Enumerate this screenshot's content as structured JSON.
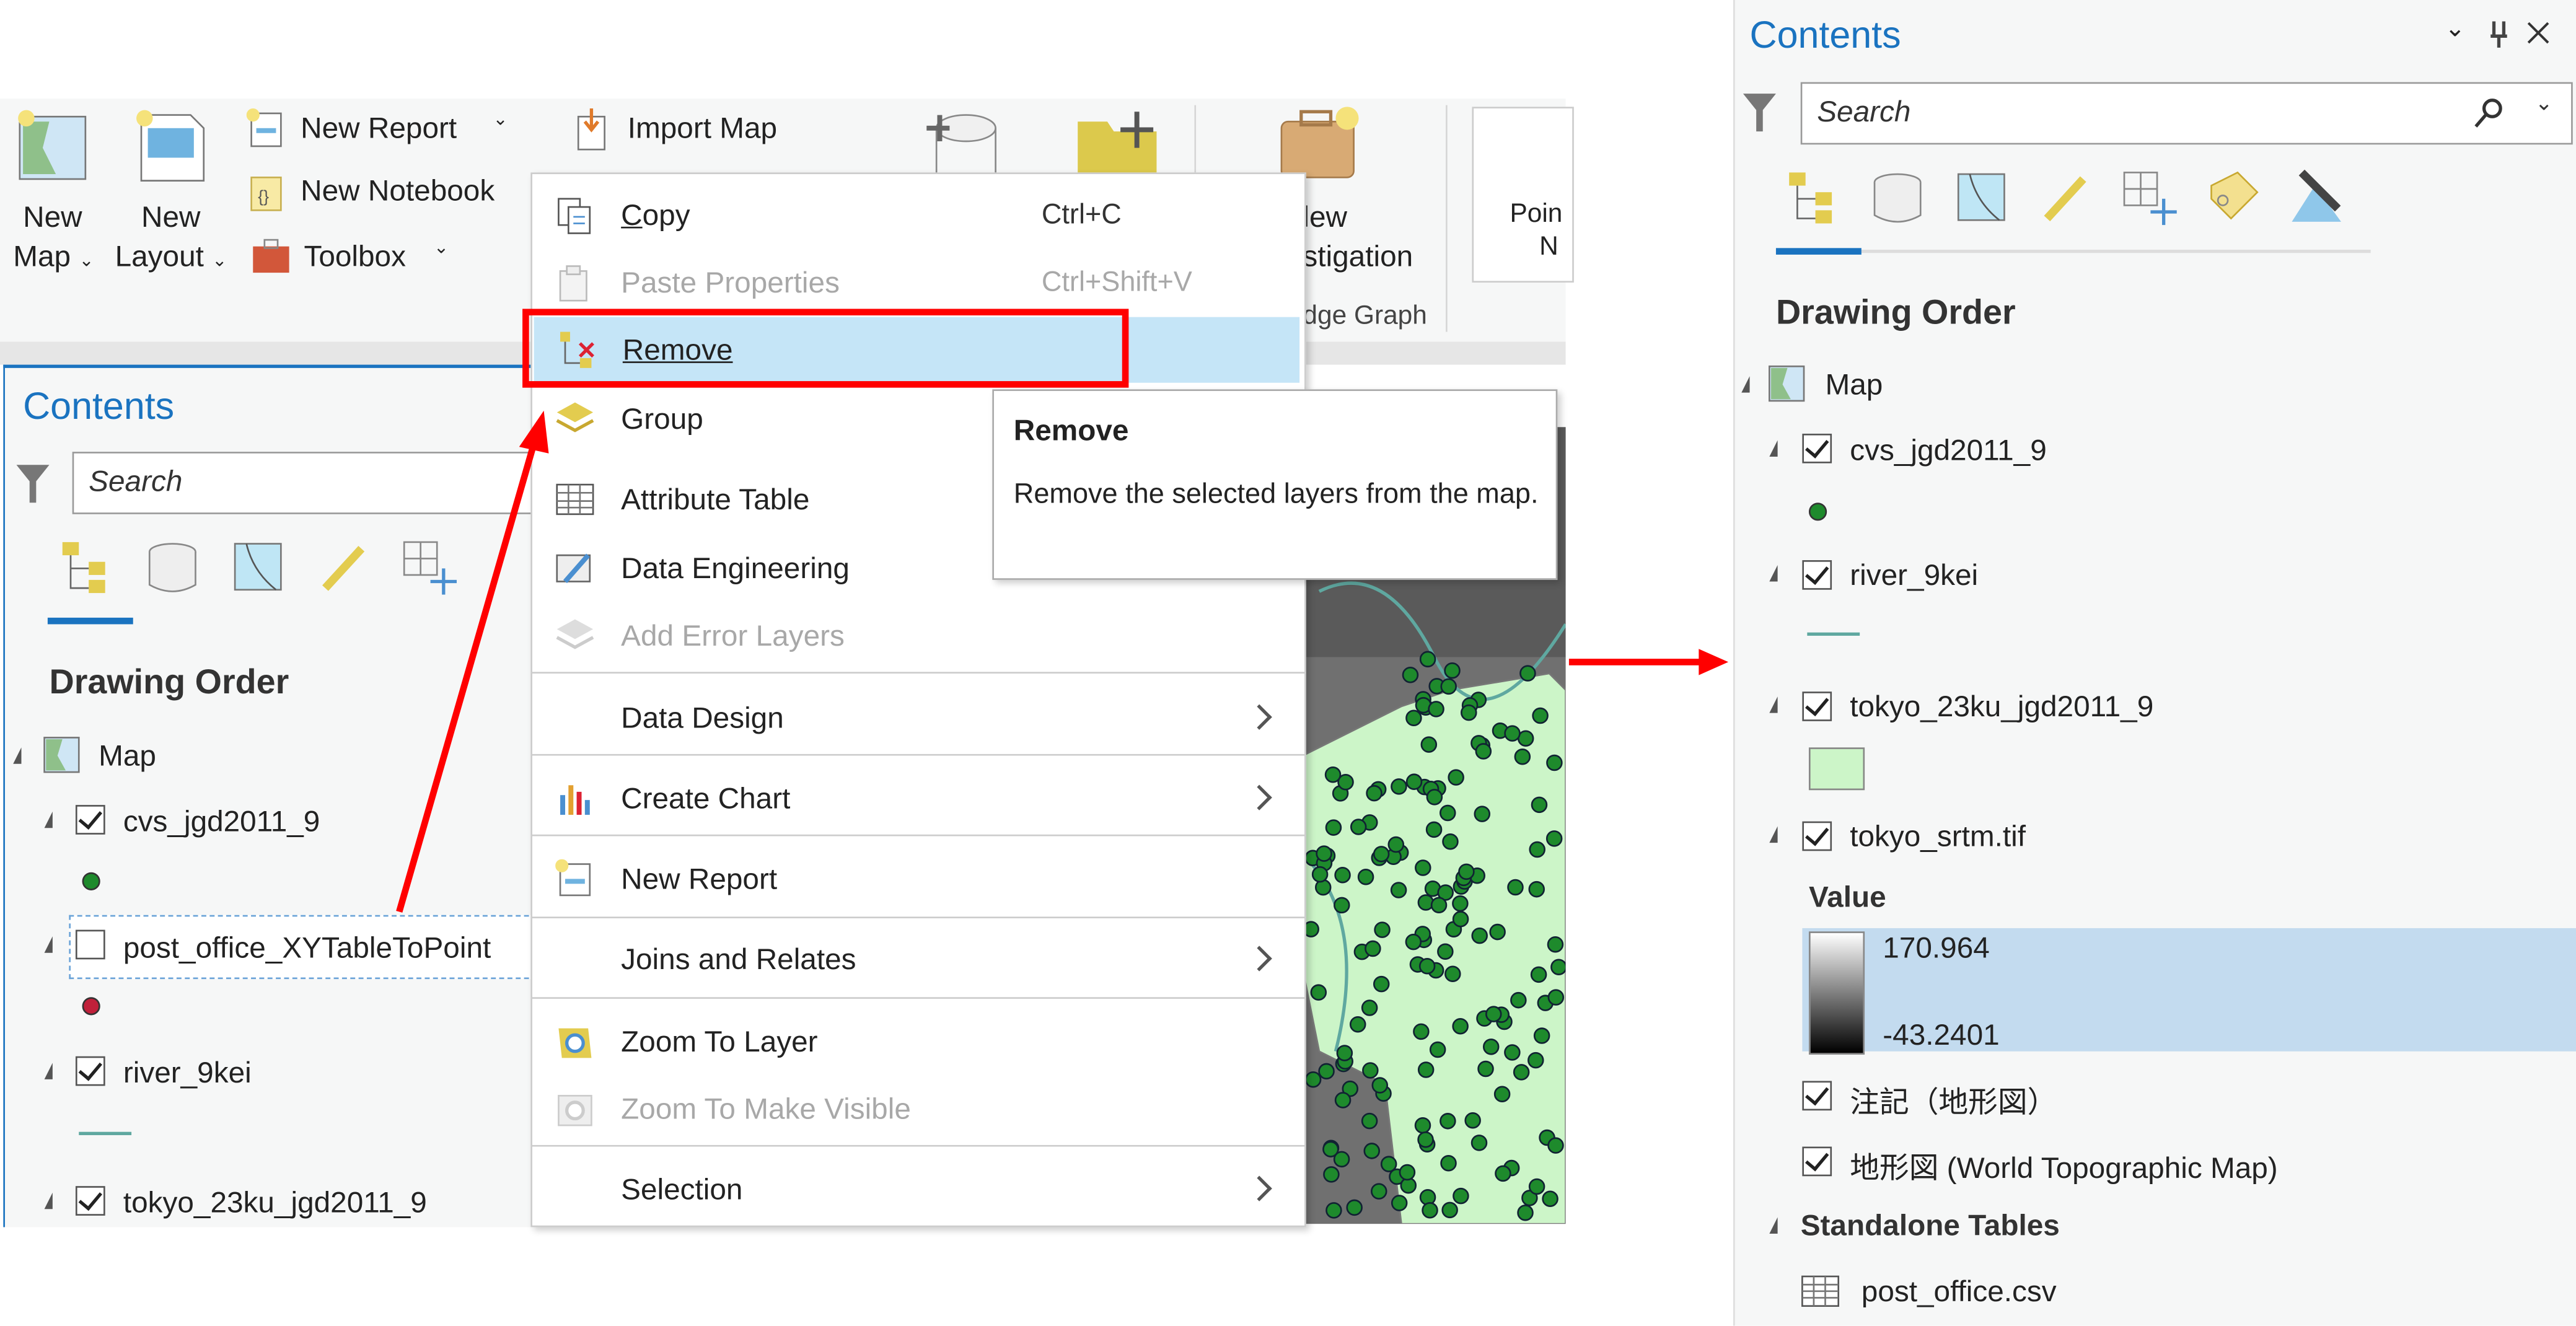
{
  "ribbon": {
    "new_map": [
      "New",
      "Map"
    ],
    "new_layout": [
      "New",
      "Layout"
    ],
    "new_report": "New Report",
    "new_notebook": "New Notebook",
    "toolbox": "Toolbox",
    "import_map": "Import Map",
    "investigation": [
      "lew",
      "stigation"
    ],
    "group_label": "dge Graph",
    "partial_button": [
      "Poin",
      "N"
    ]
  },
  "left_panel": {
    "title": "Contents",
    "search_placeholder": "Search",
    "section": "Drawing Order",
    "map": "Map",
    "layers": [
      {
        "name": "cvs_jgd2011_9",
        "checked": true,
        "symbol": "green-dot"
      },
      {
        "name": "post_office_XYTableToPoint",
        "checked": false,
        "selected": true,
        "symbol": "red-dot"
      },
      {
        "name": "river_9kei",
        "checked": true,
        "symbol": "teal-line"
      },
      {
        "name": "tokyo_23ku_jgd2011_9",
        "checked": true
      }
    ]
  },
  "context_menu": {
    "items": [
      {
        "label": "Copy",
        "shortcut": "Ctrl+C",
        "icon": "copy-icon"
      },
      {
        "label": "Paste Properties",
        "shortcut": "Ctrl+Shift+V",
        "disabled": true,
        "icon": "paste-icon"
      },
      {
        "label": "Remove",
        "highlighted": true,
        "icon": "remove-layer-icon"
      },
      {
        "label": "Group",
        "icon": "group-layers-icon"
      },
      {
        "label": "Attribute Table",
        "icon": "table-icon"
      },
      {
        "label": "Data Engineering",
        "icon": "data-engineering-icon"
      },
      {
        "label": "Add Error Layers",
        "disabled": true,
        "icon": "error-layers-icon"
      },
      {
        "label": "Data Design",
        "submenu": true
      },
      {
        "label": "Create Chart",
        "submenu": true,
        "icon": "chart-icon"
      },
      {
        "label": "New Report",
        "icon": "report-icon"
      },
      {
        "label": "Joins and Relates",
        "submenu": true
      },
      {
        "label": "Zoom To Layer",
        "icon": "zoom-layer-icon"
      },
      {
        "label": "Zoom To Make Visible",
        "disabled": true,
        "icon": "zoom-visible-icon"
      },
      {
        "label": "Selection",
        "submenu": true
      }
    ]
  },
  "tooltip": {
    "title": "Remove",
    "body": "Remove the selected layers from the map."
  },
  "right_panel": {
    "title": "Contents",
    "search_placeholder": "Search",
    "section": "Drawing Order",
    "map": "Map",
    "layers": [
      {
        "name": "cvs_jgd2011_9",
        "checked": true
      },
      {
        "name": "river_9kei",
        "checked": true
      },
      {
        "name": "tokyo_23ku_jgd2011_9",
        "checked": true
      },
      {
        "name": "tokyo_srtm.tif",
        "checked": true
      }
    ],
    "value_label": "Value",
    "value_max": "170.964",
    "value_min": "-43.2401",
    "basemaps": [
      {
        "name": "注記（地形図）",
        "checked": true
      },
      {
        "name": "地形図 (World Topographic Map)",
        "checked": true
      }
    ],
    "standalone_tables": "Standalone Tables",
    "table": "post_office.csv"
  },
  "colors": {
    "accent": "#1a73c0",
    "highlight": "#c5e5f7",
    "annotation_red": "#ff0000",
    "polygon_fill": "#ccf5c8",
    "point_green": "#1e8a2c"
  }
}
